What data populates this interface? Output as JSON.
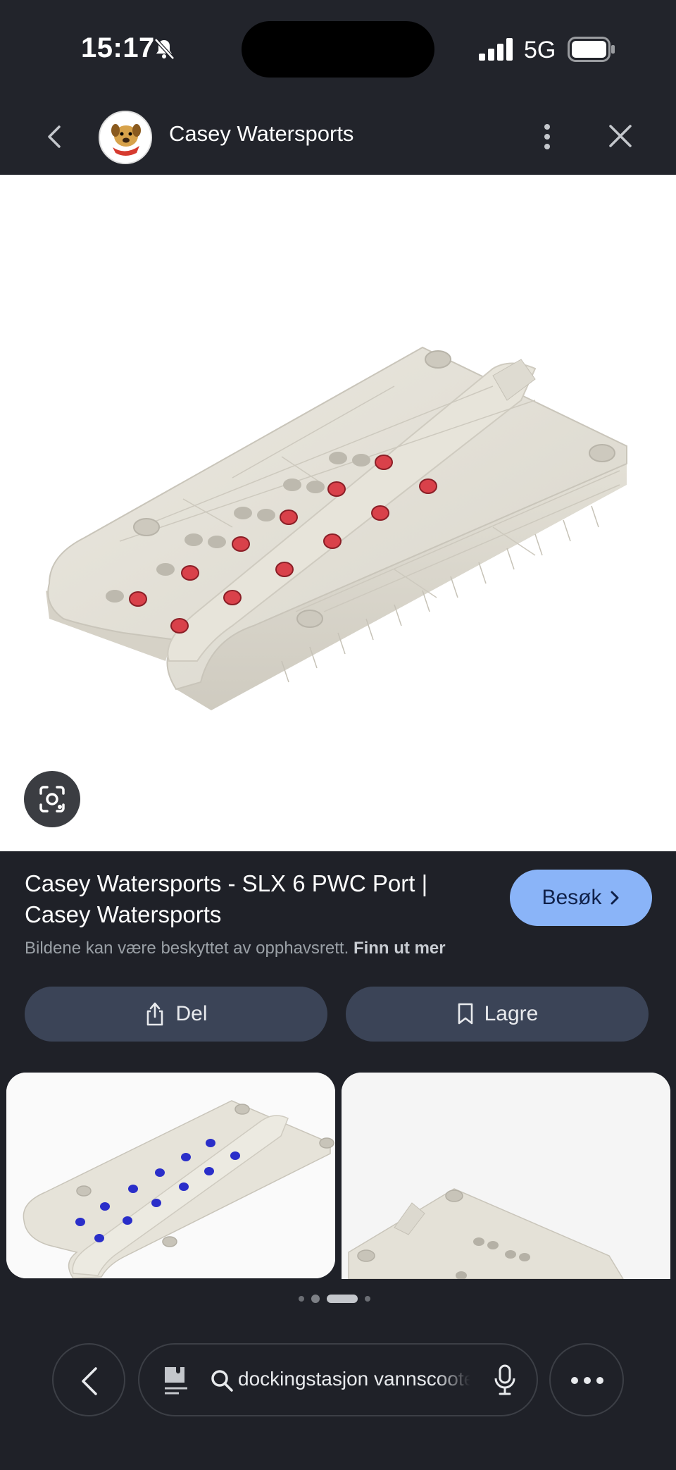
{
  "status_bar": {
    "time": "15:17",
    "network": "5G"
  },
  "header": {
    "site_name": "Casey Watersports"
  },
  "result": {
    "title": "Casey Watersports - SLX 6 PWC Port | Casey Watersports",
    "visit_label": "Besøk",
    "copyright_text": "Bildene kan være beskyttet av opphavsrett.",
    "learn_more": "Finn ut mer"
  },
  "actions": {
    "share_label": "Del",
    "save_label": "Lagre"
  },
  "pager": {
    "count": 4,
    "active_index": 2
  },
  "search": {
    "query": "dockingstasjon vannscooter"
  },
  "icons": [
    "bell-slash-icon",
    "signal-icon",
    "battery-icon",
    "back-arrow-icon",
    "more-vert-icon",
    "close-icon",
    "lens-icon",
    "chevron-right-icon",
    "share-icon",
    "bookmark-icon",
    "lens-tray-icon",
    "search-icon",
    "mic-icon",
    "ellipsis-icon"
  ],
  "colors": {
    "background": "#1f2128",
    "accent": "#8ab4f8",
    "action_button": "#3b4457",
    "roller_red": "#d9414a",
    "roller_blue": "#2a2ec9"
  }
}
